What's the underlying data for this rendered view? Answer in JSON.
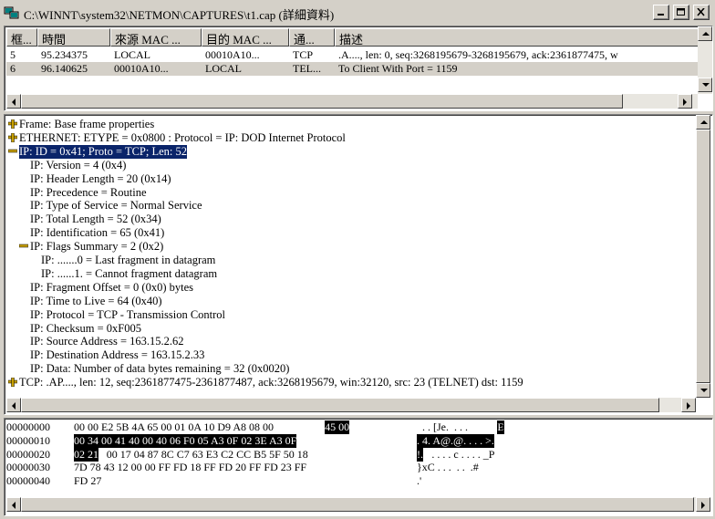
{
  "window": {
    "title": "C:\\WINNT\\system32\\NETMON\\CAPTURES\\t1.cap (詳細資料)"
  },
  "summary": {
    "columns": [
      "框...",
      "時間",
      "來源 MAC ...",
      "目的 MAC ...",
      "通...",
      "描述"
    ],
    "rows": [
      {
        "frame": "5",
        "time": "95.234375",
        "src": "LOCAL",
        "dst": "00010A10...",
        "proto": "TCP",
        "desc": ".A...., len:   0, seq:3268195679-3268195679, ack:2361877475, w"
      },
      {
        "frame": "6",
        "time": "96.140625",
        "src": "00010A10...",
        "dst": "LOCAL",
        "proto": "TEL...",
        "desc": "To Client With Port = 1159"
      }
    ]
  },
  "detail": {
    "lines": [
      {
        "text": "Frame: Base frame properties",
        "exp": "plus"
      },
      {
        "text": "ETHERNET: ETYPE = 0x0800 : Protocol = IP:  DOD Internet Protocol",
        "exp": "plus"
      },
      {
        "text": "IP: ID = 0x41; Proto = TCP; Len: 52",
        "exp": "minus"
      },
      {
        "text": "IP: Version = 4 (0x4)",
        "exp": ""
      },
      {
        "text": "IP: Header Length = 20 (0x14)",
        "exp": ""
      },
      {
        "text": "IP: Precedence = Routine",
        "exp": ""
      },
      {
        "text": "IP: Type of Service = Normal Service",
        "exp": ""
      },
      {
        "text": "IP: Total Length = 52 (0x34)",
        "exp": ""
      },
      {
        "text": "IP: Identification = 65 (0x41)",
        "exp": ""
      },
      {
        "text": "IP: Flags Summary = 2 (0x2)",
        "exp": "minus"
      },
      {
        "text": "IP: .......0 = Last fragment in datagram",
        "exp": ""
      },
      {
        "text": "IP: ......1. = Cannot fragment datagram",
        "exp": ""
      },
      {
        "text": "IP: Fragment Offset = 0 (0x0) bytes",
        "exp": ""
      },
      {
        "text": "IP: Time to Live = 64 (0x40)",
        "exp": ""
      },
      {
        "text": "IP: Protocol = TCP - Transmission Control",
        "exp": ""
      },
      {
        "text": "IP: Checksum = 0xF005",
        "exp": ""
      },
      {
        "text": "IP: Source Address = 163.15.2.62",
        "exp": ""
      },
      {
        "text": "IP: Destination Address = 163.15.2.33",
        "exp": ""
      },
      {
        "text": "IP: Data: Number of data bytes remaining = 32 (0x0020)",
        "exp": ""
      },
      {
        "text": "TCP: .AP...., len:   12, seq:2361877475-2361877487, ack:3268195679, win:32120, src:   23 (TELNET)  dst: 1159",
        "exp": "plus"
      }
    ]
  },
  "hex": {
    "rows": [
      {
        "offset": "00000000",
        "pre": "00 00 E2 5B 4A 65 00 01 0A 10 D9 A8 08 00 ",
        "hl": "45 00",
        "post": "",
        "ascii_pre": "  . . [Je.  . . .",
        "ascii_hl": "E",
        "ascii_post": "."
      },
      {
        "offset": "00000010",
        "pre": "",
        "hl": "00 34 00 41 40 00 40 06 F0 05 A3 0F 02 3E A3 0F",
        "post": "",
        "ascii_pre": "",
        "ascii_hl": ". 4. A@.@. . . . >.",
        "ascii_post": ""
      },
      {
        "offset": "00000020",
        "pre": "",
        "hl": "02 21",
        "post": " 00 17 04 87 8C C7 63 E3 C2 CC B5 5F 50 18",
        "ascii_pre": "",
        "ascii_hl": "!.",
        "ascii_post": "  . . . . c . . . . _P"
      },
      {
        "offset": "00000030",
        "pre": "7D 78 43 12 00 00 FF FD 18 FF FD 20 FF FD 23 FF",
        "hl": "",
        "post": "",
        "ascii_pre": "}xC . . .  . .  .#",
        "ascii_hl": "",
        "ascii_post": ""
      },
      {
        "offset": "00000040",
        "pre": "FD 27",
        "hl": "",
        "post": "",
        "ascii_pre": ".'",
        "ascii_hl": "",
        "ascii_post": ""
      }
    ]
  }
}
